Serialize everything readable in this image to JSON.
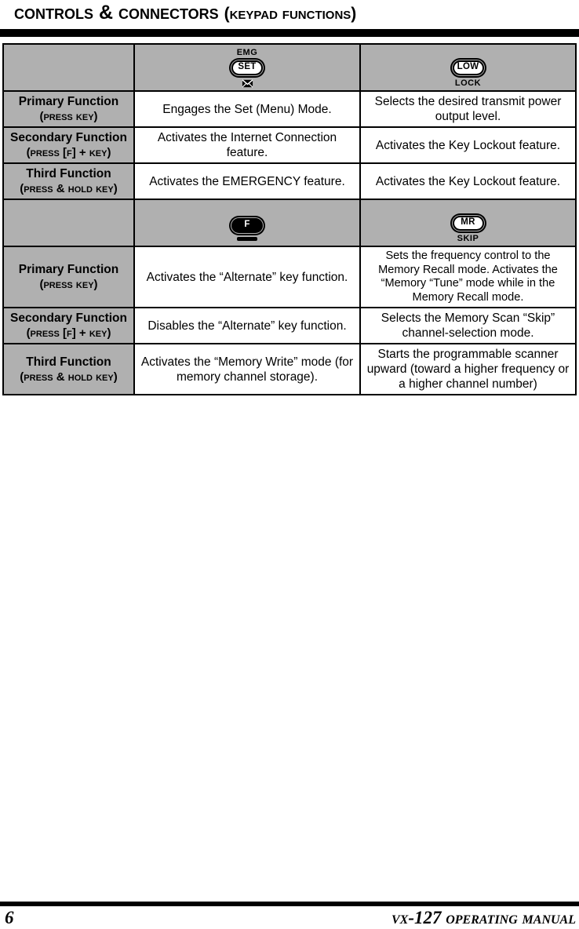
{
  "header": {
    "title_main": "Controls & Connectors",
    "title_paren": "(Keypad Functions)"
  },
  "table": {
    "blocks": [
      {
        "keys": [
          {
            "top_label": "EMG",
            "cap_label": "SET",
            "bottom_icon": "envelope-icon",
            "bottom_label": "",
            "inverted": false,
            "under_bar": false
          },
          {
            "top_label": "",
            "cap_label": "LOW",
            "bottom_icon": "",
            "bottom_label": "LOCK",
            "inverted": false,
            "under_bar": false
          }
        ],
        "rows": [
          {
            "label": "Primary Function",
            "sub": "(Press Key)",
            "mid": "Engages the Set (Menu) Mode.",
            "right": "Selects the desired transmit power output level."
          },
          {
            "label": "Secondary Function",
            "sub": "(Press [F] + Key)",
            "mid": "Activates the Internet Connection feature.",
            "right": "Activates the Key Lockout feature."
          },
          {
            "label": "Third Function",
            "sub": "(Press & Hold Key)",
            "mid": "Activates the EMERGENCY feature.",
            "right": "Activates the Key Lockout feature."
          }
        ]
      },
      {
        "keys": [
          {
            "top_label": "",
            "cap_label": "F",
            "bottom_icon": "",
            "bottom_label": "",
            "inverted": true,
            "under_bar": true
          },
          {
            "top_label": "",
            "cap_label": "MR",
            "bottom_icon": "",
            "bottom_label": "SKIP",
            "inverted": false,
            "under_bar": false
          }
        ],
        "rows": [
          {
            "label": "Primary Function",
            "sub": "(Press Key)",
            "mid": "Activates the “Alternate” key function.",
            "right": "Sets the frequency control to the Memory Recall mode. Activates the “Memory “Tune” mode while in the Memory Recall mode."
          },
          {
            "label": "Secondary Function",
            "sub": "(Press [F] + Key)",
            "mid": "Disables the “Alternate” key function.",
            "right": "Selects the Memory Scan “Skip” channel-selection mode."
          },
          {
            "label": "Third Function",
            "sub": "(Press & Hold Key)",
            "mid": "Activates the “Memory Write” mode (for memory channel storage).",
            "right": "Starts the programmable scanner upward (toward a higher frequency or a higher channel number)"
          }
        ]
      }
    ]
  },
  "footer": {
    "page_number": "6",
    "manual_title": "VX-127 Operating Manual"
  },
  "colors": {
    "header_gray": "#b0b0b0",
    "rule_black": "#000000",
    "cell_white": "#ffffff"
  }
}
